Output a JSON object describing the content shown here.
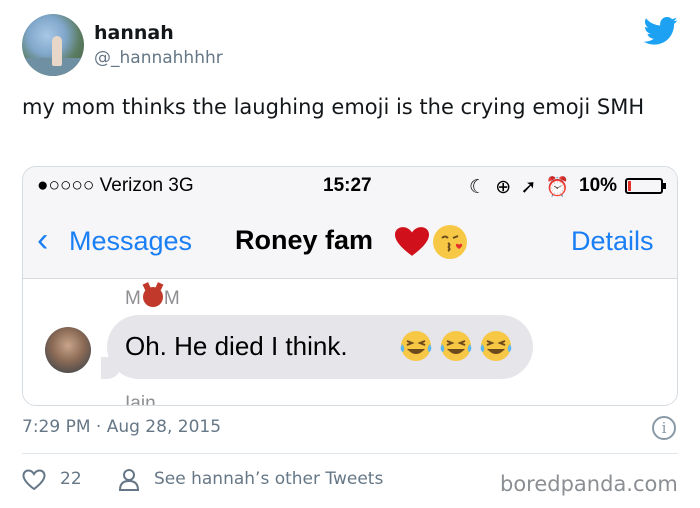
{
  "author": {
    "name": "hannah",
    "handle": "@_hannahhhhr"
  },
  "tweet_text": "my mom thinks the laughing emoji is the crying emoji SMH",
  "embedded_screenshot": {
    "status_bar": {
      "carrier": "●○○○○ Verizon  3G",
      "time": "15:27",
      "status_icons": "☾ ⊕ ➚ ⏰",
      "battery_percent": "10%",
      "battery_level": 0.1
    },
    "nav_bar": {
      "back_label": "Messages",
      "title": "Roney fam",
      "title_icons": [
        "heart-icon",
        "kissing-face-icon"
      ],
      "details_label": "Details"
    },
    "messages": [
      {
        "sender_prefix": "M",
        "sender_suffix": "M",
        "sender_icon": "devil-face-icon",
        "text": "Oh. He died I think.",
        "emojis": [
          "laughing-tears-icon",
          "laughing-tears-icon",
          "laughing-tears-icon"
        ]
      }
    ],
    "next_sender": "Iain"
  },
  "timestamp": "7:29 PM · Aug 28, 2015",
  "footer": {
    "like_count": "22",
    "other_tweets_label": "See hannah’s other Tweets"
  },
  "watermark": "boredpanda.com",
  "colors": {
    "twitter_blue": "#1da1f2",
    "ios_blue": "#1a7ef5",
    "bubble_gray": "#e5e5ea",
    "secondary_text": "#657786"
  }
}
